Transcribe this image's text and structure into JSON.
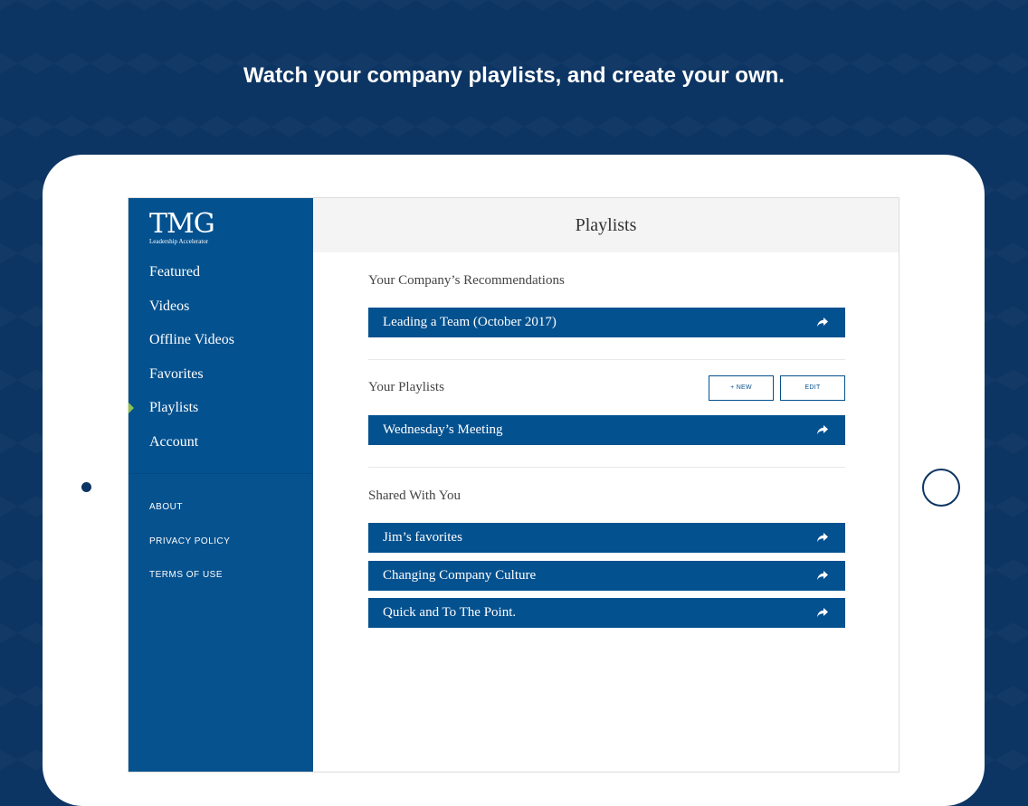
{
  "headline": "Watch your company playlists, and create your own.",
  "logo": {
    "main": "TMG",
    "sub": "Leadership Accelerator"
  },
  "sidebar": {
    "items": [
      {
        "label": "Featured"
      },
      {
        "label": "Videos"
      },
      {
        "label": "Offline Videos"
      },
      {
        "label": "Favorites"
      },
      {
        "label": "Playlists",
        "active": true
      },
      {
        "label": "Account"
      }
    ],
    "footer": [
      {
        "label": "ABOUT"
      },
      {
        "label": "PRIVACY POLICY"
      },
      {
        "label": "TERMS OF USE"
      }
    ]
  },
  "main": {
    "title": "Playlists",
    "recommendations": {
      "title": "Your Company’s Recommendations",
      "items": [
        {
          "label": "Leading a Team (October 2017)"
        }
      ]
    },
    "your_playlists": {
      "title": "Your Playlists",
      "new_label": "+ NEW",
      "edit_label": "EDIT",
      "items": [
        {
          "label": "Wednesday’s Meeting"
        }
      ]
    },
    "shared": {
      "title": "Shared With You",
      "items": [
        {
          "label": "Jim’s favorites"
        },
        {
          "label": "Changing Company Culture"
        },
        {
          "label": "Quick and To The Point."
        }
      ]
    }
  },
  "colors": {
    "background": "#0d3563",
    "brand_blue": "#04518f",
    "active_indicator": "#8bc34a"
  },
  "icons": {
    "row_action": "share-arrow-icon"
  }
}
